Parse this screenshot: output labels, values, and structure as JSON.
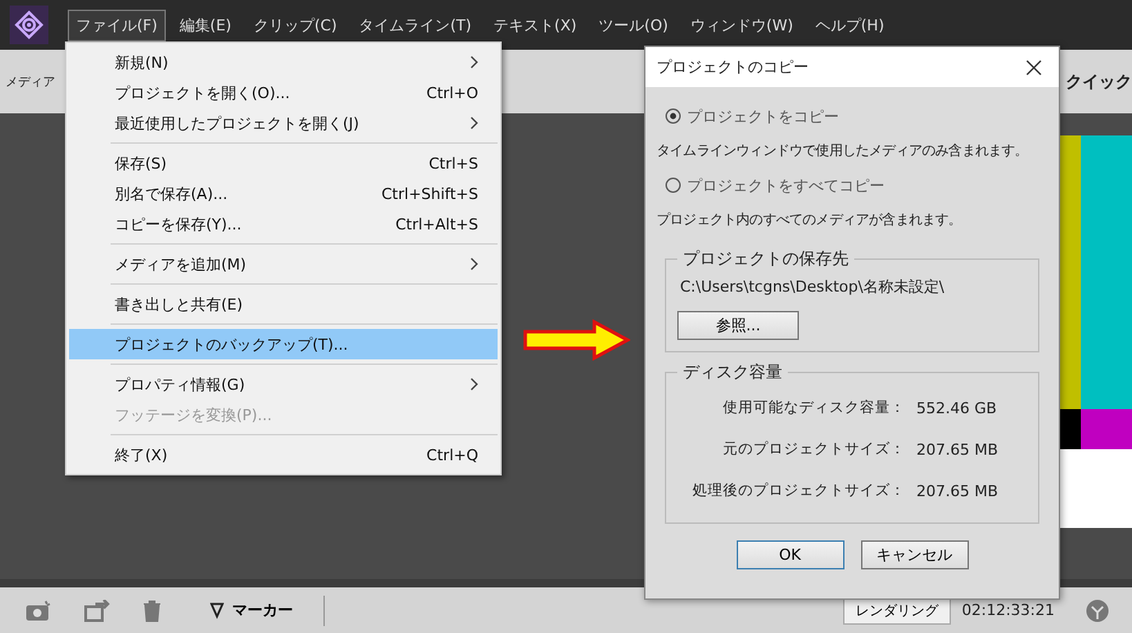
{
  "menu_bar": [
    {
      "label": "ファイル(F)",
      "selected": true
    },
    {
      "label": "編集(E)",
      "selected": false
    },
    {
      "label": "クリップ(C)",
      "selected": false
    },
    {
      "label": "タイムライン(T)",
      "selected": false
    },
    {
      "label": "テキスト(X)",
      "selected": false
    },
    {
      "label": "ツール(O)",
      "selected": false
    },
    {
      "label": "ウィンドウ(W)",
      "selected": false
    },
    {
      "label": "ヘルプ(H)",
      "selected": false
    }
  ],
  "panel_header": {
    "left_label": "メディア",
    "right_label": "クイック"
  },
  "file_menu": {
    "groups": [
      [
        {
          "label": "新規(N)",
          "submenu": true,
          "disabled": false,
          "selected": false
        },
        {
          "label": "プロジェクトを開く(O)...",
          "shortcut": "Ctrl+O",
          "submenu": false,
          "disabled": false,
          "selected": false
        },
        {
          "label": "最近使用したプロジェクトを開く(J)",
          "submenu": true,
          "disabled": false,
          "selected": false
        }
      ],
      [
        {
          "label": "保存(S)",
          "shortcut": "Ctrl+S",
          "submenu": false,
          "disabled": false,
          "selected": false
        },
        {
          "label": "別名で保存(A)...",
          "shortcut": "Ctrl+Shift+S",
          "submenu": false,
          "disabled": false,
          "selected": false
        },
        {
          "label": "コピーを保存(Y)...",
          "shortcut": "Ctrl+Alt+S",
          "submenu": false,
          "disabled": false,
          "selected": false
        }
      ],
      [
        {
          "label": "メディアを追加(M)",
          "submenu": true,
          "disabled": false,
          "selected": false
        }
      ],
      [
        {
          "label": "書き出しと共有(E)",
          "submenu": false,
          "disabled": false,
          "selected": false
        }
      ],
      [
        {
          "label": "プロジェクトのバックアップ(T)...",
          "submenu": false,
          "disabled": false,
          "selected": true
        }
      ],
      [
        {
          "label": "プロパティ情報(G)",
          "submenu": true,
          "disabled": false,
          "selected": false
        },
        {
          "label": "フッテージを変換(P)...",
          "submenu": false,
          "disabled": true,
          "selected": false
        }
      ],
      [
        {
          "label": "終了(X)",
          "shortcut": "Ctrl+Q",
          "submenu": false,
          "disabled": false,
          "selected": false
        }
      ]
    ]
  },
  "dialog": {
    "title": "プロジェクトのコピー",
    "options": [
      {
        "label": "プロジェクトをコピー",
        "selected": true,
        "description": "タイムラインウィンドウで使用したメディアのみ含まれます。"
      },
      {
        "label": "プロジェクトをすべてコピー",
        "selected": false,
        "description": "プロジェクト内のすべてのメディアが含まれます。"
      }
    ],
    "destination": {
      "legend": "プロジェクトの保存先",
      "path": "C:\\Users\\tcgns\\Desktop\\名称未設定\\",
      "browse_button": "参照..."
    },
    "disk": {
      "legend": "ディスク容量",
      "rows": [
        {
          "label": "使用可能なディスク容量：",
          "value": "552.46 GB"
        },
        {
          "label": "元のプロジェクトサイズ：",
          "value": "207.65 MB"
        },
        {
          "label": "処理後のプロジェクトサイズ：",
          "value": "207.65 MB"
        }
      ]
    },
    "buttons": [
      "OK",
      "キャンセル"
    ]
  },
  "toolbar": {
    "marker_label": "マーカー",
    "render_button": "レンダリング",
    "timecode": "02:12:33:21"
  }
}
